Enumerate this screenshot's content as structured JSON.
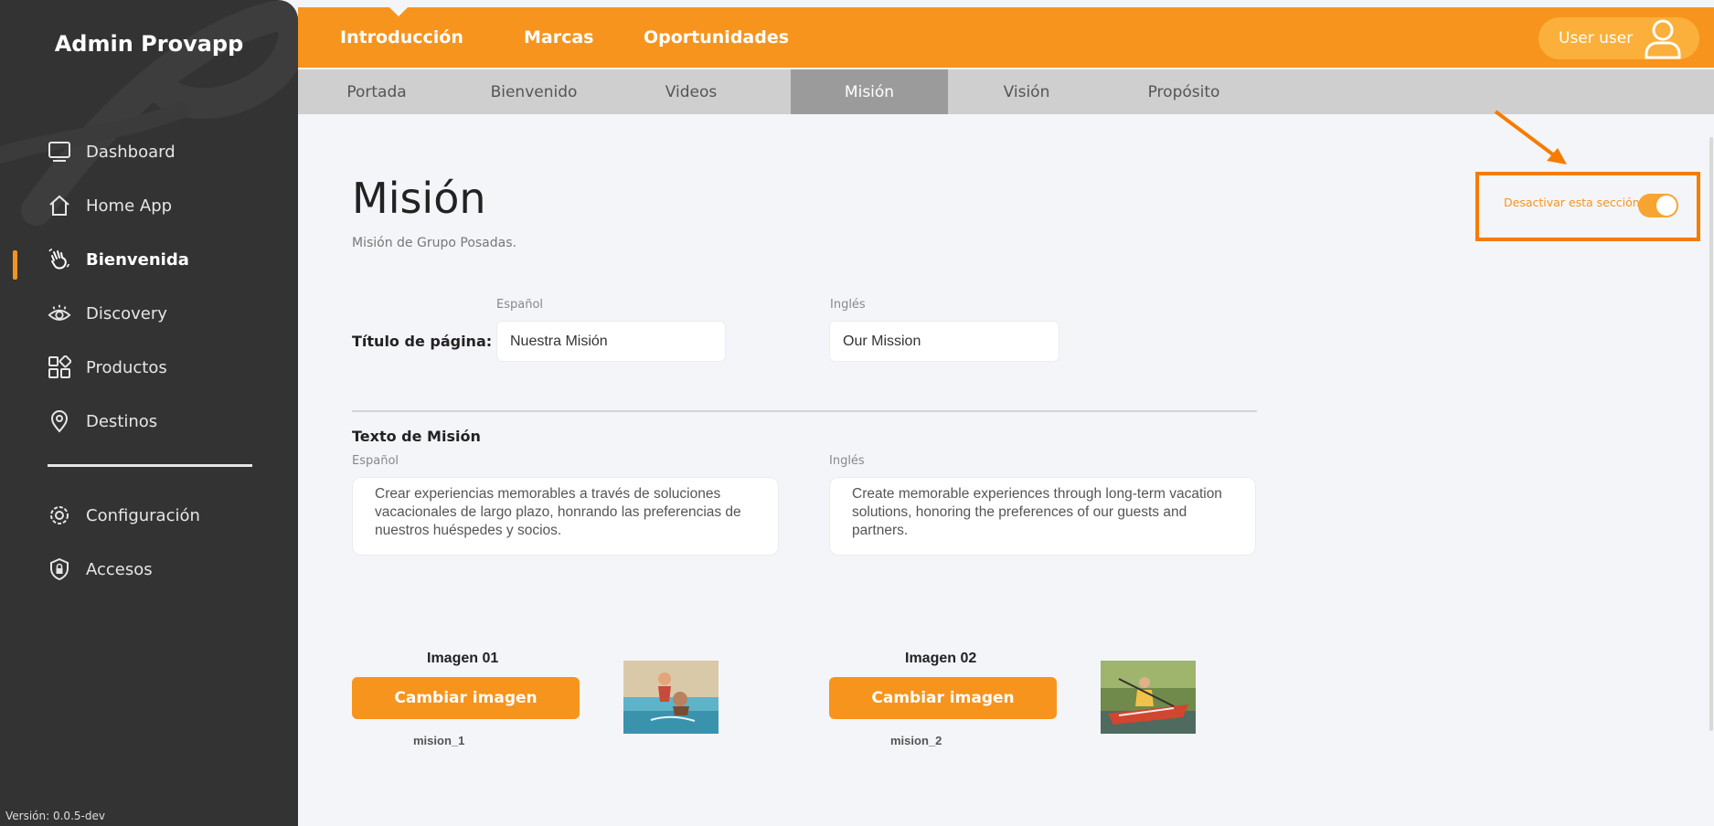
{
  "app": {
    "brand": "Admin Provapp",
    "version": "Versión: 0.0.5-dev"
  },
  "sidebar": {
    "items": [
      {
        "label": "Dashboard",
        "icon": "monitor-icon"
      },
      {
        "label": "Home App",
        "icon": "home-icon"
      },
      {
        "label": "Bienvenida",
        "icon": "waving-hand-icon",
        "active": true
      },
      {
        "label": "Discovery",
        "icon": "eye-icon"
      },
      {
        "label": "Productos",
        "icon": "grid-icon"
      },
      {
        "label": "Destinos",
        "icon": "location-pin-icon"
      }
    ],
    "bottom_items": [
      {
        "label": "Configuración",
        "icon": "gear-icon"
      },
      {
        "label": "Accesos",
        "icon": "shield-lock-icon"
      }
    ]
  },
  "topnav": {
    "items": [
      "Introducción",
      "Marcas",
      "Oportunidades"
    ],
    "active": "Introducción",
    "user_label": "User user",
    "accent_color": "#f7941d"
  },
  "subtabs": {
    "items": [
      "Portada",
      "Bienvenido",
      "Videos",
      "Misión",
      "Visión",
      "Propósito"
    ],
    "active": "Misión"
  },
  "page": {
    "title": "Misión",
    "subtitle": "Misión de Grupo Posadas.",
    "toggle_label": "Desactivar esta sección",
    "toggle_on": true
  },
  "form": {
    "page_title_label": "Título de página:",
    "lang_es": "Español",
    "lang_en": "Inglés",
    "title_es": "Nuestra Misión",
    "title_en": "Our Mission",
    "text_section_label": "Texto de Misión",
    "text_es": "Crear experiencias memorables a través de soluciones vacacionales de largo plazo, honrando las preferencias de nuestros huéspedes y socios.",
    "text_en": "Create memorable experiences through long-term vacation solutions, honoring the preferences of our guests and partners."
  },
  "images": [
    {
      "label": "Imagen 01",
      "button": "Cambiar imagen",
      "name": "mision_1"
    },
    {
      "label": "Imagen 02",
      "button": "Cambiar imagen",
      "name": "mision_2"
    }
  ]
}
